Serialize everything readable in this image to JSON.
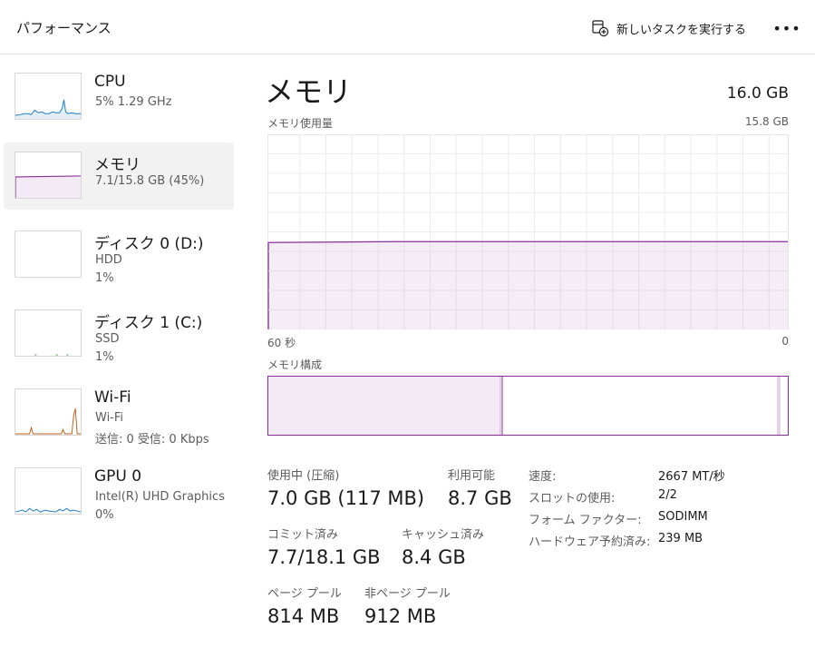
{
  "header": {
    "title": "パフォーマンス",
    "run_task_label": "新しいタスクを実行する",
    "more_label": "•••"
  },
  "sidebar": {
    "items": [
      {
        "name": "CPU",
        "line1": "5%  1.29 GHz",
        "line2": "",
        "color": "#1a7bc7"
      },
      {
        "name": "メモリ",
        "line1": "7.1/15.8 GB (45%)",
        "line2": "",
        "color": "#8b2d9e"
      },
      {
        "name": "ディスク 0 (D:)",
        "line1": "HDD",
        "line2": "1%",
        "color": "#3c8d2f"
      },
      {
        "name": "ディスク 1 (C:)",
        "line1": "SSD",
        "line2": "1%",
        "color": "#3c8d2f"
      },
      {
        "name": "Wi-Fi",
        "line1": "Wi-Fi",
        "line2": "送信: 0  受信: 0 Kbps",
        "color": "#c0601a"
      },
      {
        "name": "GPU 0",
        "line1": "Intel(R) UHD Graphics",
        "line2": "0%",
        "color": "#1a7bc7"
      }
    ]
  },
  "main": {
    "title": "メモリ",
    "capacity": "16.0 GB",
    "usage_label": "メモリ使用量",
    "usage_max": "15.8 GB",
    "time_left": "60 秒",
    "time_right": "0",
    "composition_label": "メモリ構成",
    "accent_color": "#8b2d9e",
    "usage_fraction": 0.45
  },
  "stats": {
    "in_use_label": "使用中 (圧縮)",
    "in_use_value": "7.0 GB (117 MB)",
    "available_label": "利用可能",
    "available_value": "8.7 GB",
    "committed_label": "コミット済み",
    "committed_value": "7.7/18.1 GB",
    "cached_label": "キャッシュ済み",
    "cached_value": "8.4 GB",
    "paged_pool_label": "ページ プール",
    "paged_pool_value": "814 MB",
    "nonpaged_pool_label": "非ページ プール",
    "nonpaged_pool_value": "912 MB"
  },
  "specs": [
    {
      "key": "速度:",
      "value": "2667 MT/秒"
    },
    {
      "key": "スロットの使用:",
      "value": "2/2"
    },
    {
      "key": "フォーム ファクター:",
      "value": "SODIMM"
    },
    {
      "key": "ハードウェア予約済み:",
      "value": "239 MB"
    }
  ]
}
